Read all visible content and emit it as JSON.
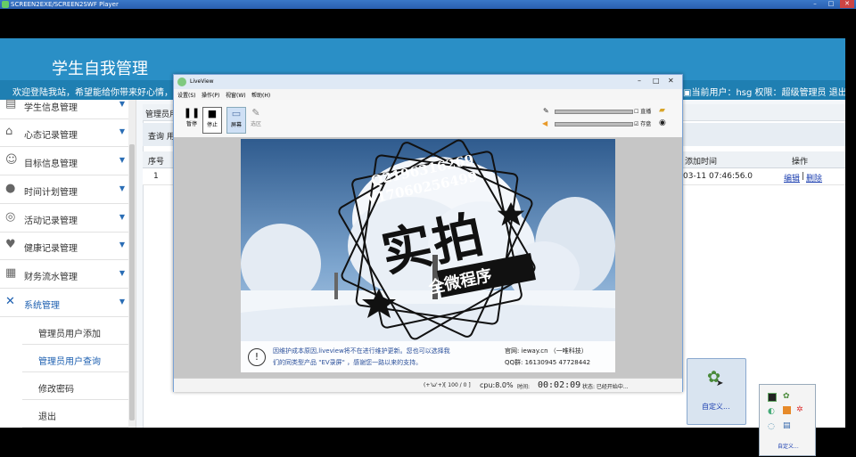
{
  "player": {
    "title": "SCREEN2EXE/SCREEN2SWF Player"
  },
  "app": {
    "title": "学生自我管理",
    "welcome": "欢迎登陆我站，希望能给你带来好心情，",
    "user_info": "当前用户：hsg  权限：超级管理员  退出",
    "sidebar": [
      {
        "label": "学生信息管理",
        "icon": "user-card-icon"
      },
      {
        "label": "心态记录管理",
        "icon": "home-icon"
      },
      {
        "label": "目标信息管理",
        "icon": "users-icon"
      },
      {
        "label": "时间计划管理",
        "icon": "person-icon"
      },
      {
        "label": "活动记录管理",
        "icon": "chat-icon"
      },
      {
        "label": "健康记录管理",
        "icon": "heart-icon"
      },
      {
        "label": "财务流水管理",
        "icon": "briefcase-icon"
      },
      {
        "label": "系统管理",
        "icon": "tools-icon"
      }
    ],
    "submenu": [
      {
        "label": "管理员用户添加"
      },
      {
        "label": "管理员用户查询"
      },
      {
        "label": "修改密码"
      },
      {
        "label": "退出"
      }
    ],
    "tab_label": "管理员用户",
    "query_label": "查询 用",
    "table": {
      "headers": {
        "index": "序号",
        "time": "添加时间",
        "ops": "操作"
      },
      "rows": [
        {
          "index": "1",
          "time": "03-11 07:46:56.0",
          "edit": "编辑",
          "sep": "|",
          "delete": "删除"
        }
      ]
    }
  },
  "liveview": {
    "title": "LiveView",
    "menu": [
      "设置(S)",
      "操作(P)",
      "视窗(W)",
      "帮助(H)"
    ],
    "toolbar": {
      "pause": "暂停",
      "stop": "停止",
      "screen": "屏幕",
      "select": "选区",
      "mic_check": "直播",
      "save_check": "存盘"
    },
    "watermark": {
      "line1": "Q2196316269",
      "line2": "V17060256499",
      "big": "实拍",
      "banner": "全微程序"
    },
    "notice": {
      "text1": "因维护成本原因,liveview将不在进行维护更新。您也可以选择我",
      "text2": "们的同类型产品 \"EV录屏\" ，感谢您一路以来的支持。",
      "site": "官网: ieway.cn （一唯科技）",
      "qq": "QQ群: 16130945  47728442"
    },
    "status": {
      "counter": "(+'ω'+)[ 100 / 0 ]",
      "cpu": "cpu:8.0%",
      "time_label": "时间:",
      "time": "00:02:09",
      "state": "状态: 已经开始中..."
    }
  },
  "popups": {
    "custom1": "自定义...",
    "custom2": "自定义..."
  }
}
